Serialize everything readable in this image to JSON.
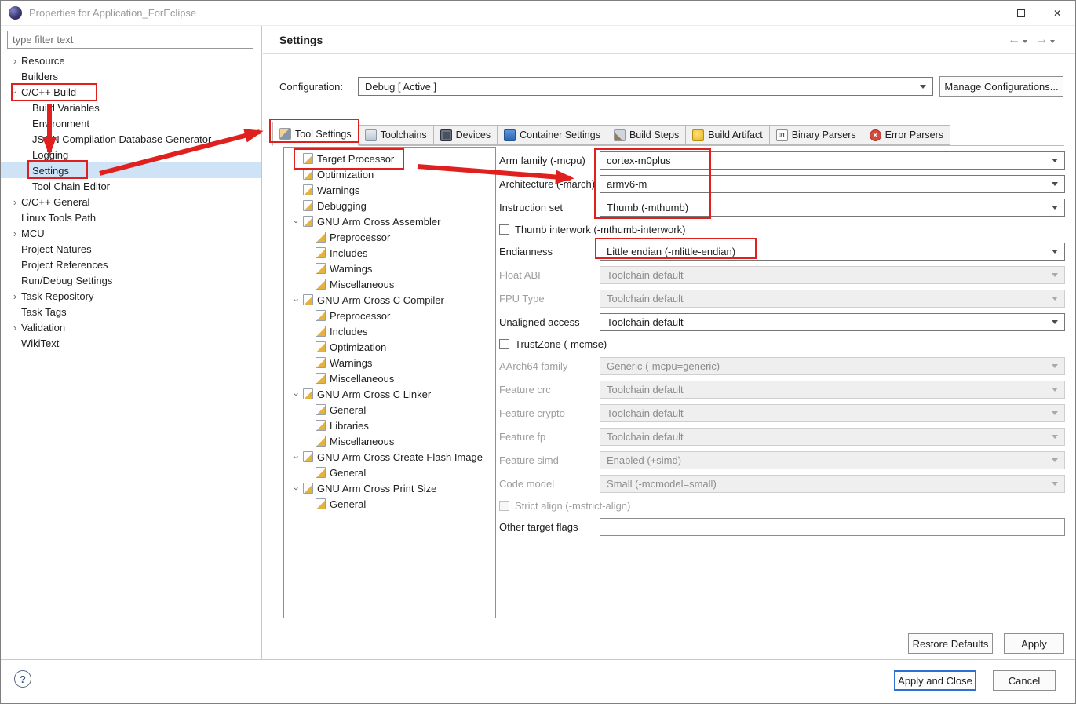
{
  "window": {
    "title": "Properties for Application_ForEclipse"
  },
  "colors": {
    "annotation": "#e0201f",
    "default_button_border": "#2e6fd0",
    "selection": "#cfe3f7"
  },
  "sidebar": {
    "filter_placeholder": "type filter text",
    "tree": [
      {
        "label": "Resource",
        "arrow": "collapsed",
        "indent": 0,
        "state": ""
      },
      {
        "label": "Builders",
        "arrow": "",
        "indent": 0,
        "state": ""
      },
      {
        "label": "C/C++ Build",
        "arrow": "expanded",
        "indent": 0,
        "state": ""
      },
      {
        "label": "Build Variables",
        "arrow": "",
        "indent": 1,
        "state": ""
      },
      {
        "label": "Environment",
        "arrow": "",
        "indent": 1,
        "state": ""
      },
      {
        "label": "JSON Compilation Database Generator",
        "arrow": "",
        "indent": 1,
        "state": ""
      },
      {
        "label": "Logging",
        "arrow": "",
        "indent": 1,
        "state": ""
      },
      {
        "label": "Settings",
        "arrow": "",
        "indent": 1,
        "state": "selected"
      },
      {
        "label": "Tool Chain Editor",
        "arrow": "",
        "indent": 1,
        "state": ""
      },
      {
        "label": "C/C++ General",
        "arrow": "collapsed",
        "indent": 0,
        "state": ""
      },
      {
        "label": "Linux Tools Path",
        "arrow": "",
        "indent": 0,
        "state": ""
      },
      {
        "label": "MCU",
        "arrow": "collapsed",
        "indent": 0,
        "state": ""
      },
      {
        "label": "Project Natures",
        "arrow": "",
        "indent": 0,
        "state": ""
      },
      {
        "label": "Project References",
        "arrow": "",
        "indent": 0,
        "state": ""
      },
      {
        "label": "Run/Debug Settings",
        "arrow": "",
        "indent": 0,
        "state": ""
      },
      {
        "label": "Task Repository",
        "arrow": "collapsed",
        "indent": 0,
        "state": ""
      },
      {
        "label": "Task Tags",
        "arrow": "",
        "indent": 0,
        "state": ""
      },
      {
        "label": "Validation",
        "arrow": "collapsed",
        "indent": 0,
        "state": ""
      },
      {
        "label": "WikiText",
        "arrow": "",
        "indent": 0,
        "state": ""
      }
    ]
  },
  "main": {
    "title": "Settings",
    "configuration": {
      "label": "Configuration:",
      "value": "Debug  [ Active ]",
      "manage_button": "Manage Configurations..."
    },
    "tabs": [
      {
        "label": "Tool Settings",
        "icon": "tool-settings-icon",
        "state": "selected"
      },
      {
        "label": "Toolchains",
        "icon": "toolchains-icon",
        "state": ""
      },
      {
        "label": "Devices",
        "icon": "devices-icon",
        "state": ""
      },
      {
        "label": "Container Settings",
        "icon": "container-settings-icon",
        "state": ""
      },
      {
        "label": "Build Steps",
        "icon": "build-steps-icon",
        "state": ""
      },
      {
        "label": "Build Artifact",
        "icon": "build-artifact-icon",
        "state": ""
      },
      {
        "label": "Binary Parsers",
        "icon": "binary-parsers-icon",
        "state": ""
      },
      {
        "label": "Error Parsers",
        "icon": "error-parsers-icon",
        "state": ""
      }
    ],
    "tool_tree": [
      {
        "label": "Target Processor",
        "arrow": "",
        "indent": 0,
        "state": "selected"
      },
      {
        "label": "Optimization",
        "arrow": "",
        "indent": 0,
        "state": ""
      },
      {
        "label": "Warnings",
        "arrow": "",
        "indent": 0,
        "state": ""
      },
      {
        "label": "Debugging",
        "arrow": "",
        "indent": 0,
        "state": ""
      },
      {
        "label": "GNU Arm Cross Assembler",
        "arrow": "expanded",
        "indent": 0,
        "state": ""
      },
      {
        "label": "Preprocessor",
        "arrow": "",
        "indent": 1,
        "state": ""
      },
      {
        "label": "Includes",
        "arrow": "",
        "indent": 1,
        "state": ""
      },
      {
        "label": "Warnings",
        "arrow": "",
        "indent": 1,
        "state": ""
      },
      {
        "label": "Miscellaneous",
        "arrow": "",
        "indent": 1,
        "state": ""
      },
      {
        "label": "GNU Arm Cross C Compiler",
        "arrow": "expanded",
        "indent": 0,
        "state": ""
      },
      {
        "label": "Preprocessor",
        "arrow": "",
        "indent": 1,
        "state": ""
      },
      {
        "label": "Includes",
        "arrow": "",
        "indent": 1,
        "state": ""
      },
      {
        "label": "Optimization",
        "arrow": "",
        "indent": 1,
        "state": ""
      },
      {
        "label": "Warnings",
        "arrow": "",
        "indent": 1,
        "state": ""
      },
      {
        "label": "Miscellaneous",
        "arrow": "",
        "indent": 1,
        "state": ""
      },
      {
        "label": "GNU Arm Cross C Linker",
        "arrow": "expanded",
        "indent": 0,
        "state": ""
      },
      {
        "label": "General",
        "arrow": "",
        "indent": 1,
        "state": ""
      },
      {
        "label": "Libraries",
        "arrow": "",
        "indent": 1,
        "state": ""
      },
      {
        "label": "Miscellaneous",
        "arrow": "",
        "indent": 1,
        "state": ""
      },
      {
        "label": "GNU Arm Cross Create Flash Image",
        "arrow": "expanded",
        "indent": 0,
        "state": ""
      },
      {
        "label": "General",
        "arrow": "",
        "indent": 1,
        "state": ""
      },
      {
        "label": "GNU Arm Cross Print Size",
        "arrow": "expanded",
        "indent": 0,
        "state": ""
      },
      {
        "label": "General",
        "arrow": "",
        "indent": 1,
        "state": ""
      }
    ],
    "form": {
      "rows": [
        {
          "type": "select",
          "label": "Arm family (-mcpu)",
          "value": "cortex-m0plus",
          "state": "",
          "interactable": "true"
        },
        {
          "type": "select",
          "label": "Architecture (-march)",
          "value": "armv6-m",
          "state": "",
          "interactable": "true"
        },
        {
          "type": "select",
          "label": "Instruction set",
          "value": "Thumb (-mthumb)",
          "state": "",
          "interactable": "true"
        },
        {
          "type": "checkbox",
          "label": "Thumb interwork (-mthumb-interwork)",
          "value": "",
          "state": "",
          "interactable": "true"
        },
        {
          "type": "select",
          "label": "Endianness",
          "value": "Little endian (-mlittle-endian)",
          "state": "",
          "interactable": "true"
        },
        {
          "type": "select",
          "label": "Float ABI",
          "value": "Toolchain default",
          "state": "disabled",
          "interactable": "false"
        },
        {
          "type": "select",
          "label": "FPU Type",
          "value": "Toolchain default",
          "state": "disabled",
          "interactable": "false"
        },
        {
          "type": "select",
          "label": "Unaligned access",
          "value": "Toolchain default",
          "state": "",
          "interactable": "true"
        },
        {
          "type": "checkbox",
          "label": "TrustZone (-mcmse)",
          "value": "",
          "state": "",
          "interactable": "true"
        },
        {
          "type": "select",
          "label": "AArch64 family",
          "value": "Generic (-mcpu=generic)",
          "state": "disabled",
          "interactable": "false"
        },
        {
          "type": "select",
          "label": "Feature crc",
          "value": "Toolchain default",
          "state": "disabled",
          "interactable": "false"
        },
        {
          "type": "select",
          "label": "Feature crypto",
          "value": "Toolchain default",
          "state": "disabled",
          "interactable": "false"
        },
        {
          "type": "select",
          "label": "Feature fp",
          "value": "Toolchain default",
          "state": "disabled",
          "interactable": "false"
        },
        {
          "type": "select",
          "label": "Feature simd",
          "value": "Enabled (+simd)",
          "state": "disabled",
          "interactable": "false"
        },
        {
          "type": "select",
          "label": "Code model",
          "value": "Small (-mcmodel=small)",
          "state": "disabled",
          "interactable": "false"
        },
        {
          "type": "checkbox",
          "label": "Strict align (-mstrict-align)",
          "value": "",
          "state": "disabled",
          "interactable": "false"
        },
        {
          "type": "text",
          "label": "Other target flags",
          "value": "",
          "state": "",
          "interactable": "true"
        }
      ]
    },
    "buttons": {
      "restore_defaults": "Restore Defaults",
      "apply": "Apply"
    }
  },
  "footer": {
    "help_label": "?",
    "apply_close": "Apply and Close",
    "cancel": "Cancel"
  }
}
